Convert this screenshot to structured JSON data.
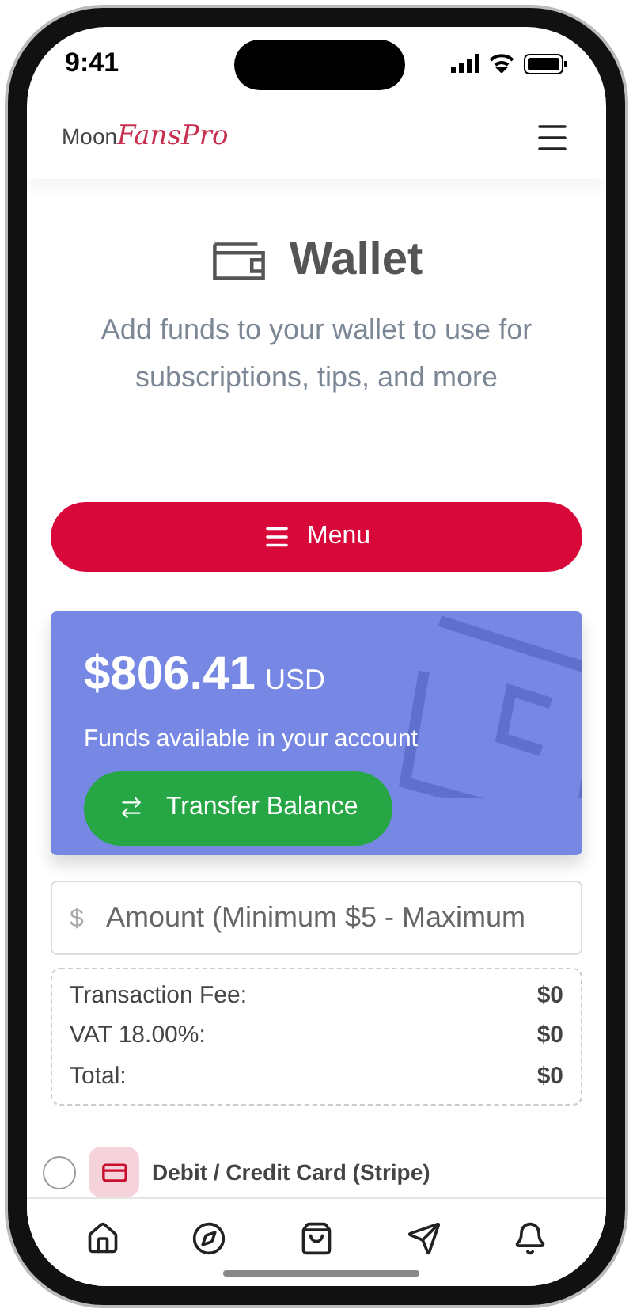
{
  "status_bar": {
    "time": "9:41"
  },
  "header": {
    "logo_plain": "Moon",
    "logo_script": "FansPro"
  },
  "wallet": {
    "title": "Wallet",
    "subtitle": "Add funds to your wallet to use for subscriptions, tips, and more"
  },
  "menu_button": {
    "label": "Menu"
  },
  "balance_card": {
    "amount": "$806.41",
    "currency": "USD",
    "caption": "Funds available in your account",
    "transfer_button": "Transfer Balance"
  },
  "amount_field": {
    "prefix": "$",
    "placeholder": "Amount (Minimum $5 - Maximum"
  },
  "fees": [
    {
      "label": "Transaction Fee:",
      "value": "$0"
    },
    {
      "label": "VAT 18.00%:",
      "value": "$0"
    },
    {
      "label": "Total:",
      "value": "$0"
    }
  ],
  "payment_methods": [
    {
      "label": "Debit / Credit Card (Stripe)",
      "selected": false
    }
  ],
  "bottom_nav": [
    {
      "kind": "home"
    },
    {
      "kind": "explore"
    },
    {
      "kind": "shop"
    },
    {
      "kind": "send"
    },
    {
      "kind": "notifications"
    }
  ]
}
